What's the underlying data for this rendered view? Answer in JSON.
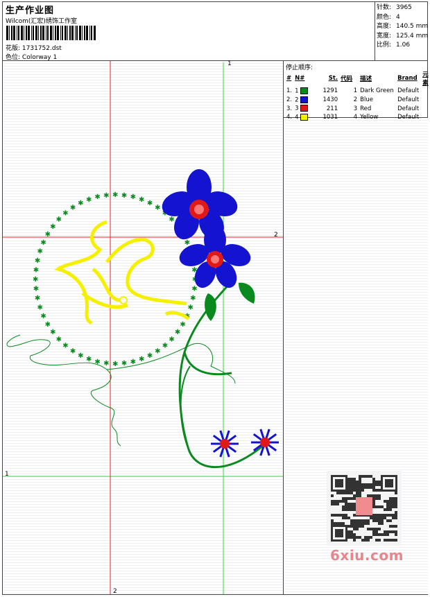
{
  "header": {
    "title": "生产作业图",
    "studio": "Wilcom(汇宏)绣饰工作室",
    "file_label": "花版:",
    "file_value": "1731752.dst",
    "colorway_label": "色位:",
    "colorway_value": "Colorway 1"
  },
  "stats": [
    {
      "label": "针数:",
      "value": "3965"
    },
    {
      "label": "颜色:",
      "value": "4"
    },
    {
      "label": "高度:",
      "value": "140.5 mm"
    },
    {
      "label": "宽度:",
      "value": "125.4 mm"
    },
    {
      "label": "比例:",
      "value": "1.06"
    }
  ],
  "stop_sequence": {
    "title": "停止顺序:",
    "headers": [
      "#",
      "N#",
      "St.",
      "代码",
      "描述",
      "Brand",
      "元素"
    ],
    "rows": [
      {
        "num": "1.",
        "n": "1",
        "color": "#0a8a1e",
        "st": "1291",
        "code": "1",
        "desc": "Dark Green",
        "brand": "Default"
      },
      {
        "num": "2.",
        "n": "2",
        "color": "#1414d0",
        "st": "1430",
        "code": "2",
        "desc": "Blue",
        "brand": "Default"
      },
      {
        "num": "3.",
        "n": "3",
        "color": "#e01818",
        "st": "211",
        "code": "3",
        "desc": "Red",
        "brand": "Default"
      },
      {
        "num": "4.",
        "n": "4",
        "color": "#f5f000",
        "st": "1031",
        "code": "4",
        "desc": "Yellow",
        "brand": "Default"
      }
    ]
  },
  "guides": {
    "green_label": "1",
    "red_label": "2"
  },
  "watermark": "6xiu.com",
  "colors": {
    "green": "#0a8a1e",
    "blue": "#1414d0",
    "red": "#e01818",
    "yellow": "#f5f000",
    "guide_green": "#33dd33",
    "guide_red": "#ee2222"
  }
}
